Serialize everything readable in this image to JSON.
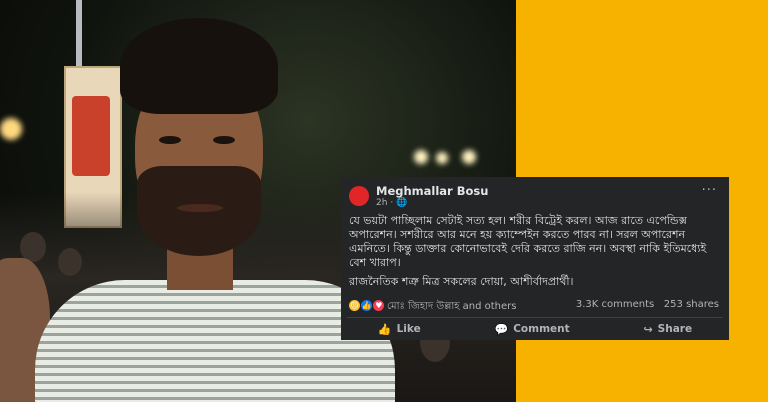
{
  "post": {
    "author": "Meghmallar Bosu",
    "time": "2h",
    "visibility_icon": "globe-icon",
    "more_label": "···",
    "text_p1": "যে ভয়টা পাচ্ছিলাম সেটাই সত্য হল। শরীর বিট্রেই করল। আজ রাতে এপেন্ডিক্স অপারেশন। সশরীরে আর মনে হয় ক্যাম্পেইন করতে পারব না। সরল অপারেশন এমনিতে। কিন্তু ডাক্তার কোনোভাবেই দেরি করতে রাজি নন। অবস্থা নাকি ইতিমধ্যেই বেশ খারাপ।",
    "text_p2": "রাজনৈতিক শত্রু মিত্র সকলের দোয়া, আশীর্বাদপ্রার্থী।",
    "reacted_by": "মোঃ জিহাদ উল্লাহ and others",
    "comments": "3.3K comments",
    "shares": "253 shares",
    "reaction_icons": [
      "sad-icon",
      "like-icon",
      "love-icon"
    ],
    "actions": {
      "like": "Like",
      "comment": "Comment",
      "share": "Share"
    }
  },
  "colors": {
    "background": "#f7b200",
    "card": "#242526",
    "avatar": "#e02626"
  }
}
